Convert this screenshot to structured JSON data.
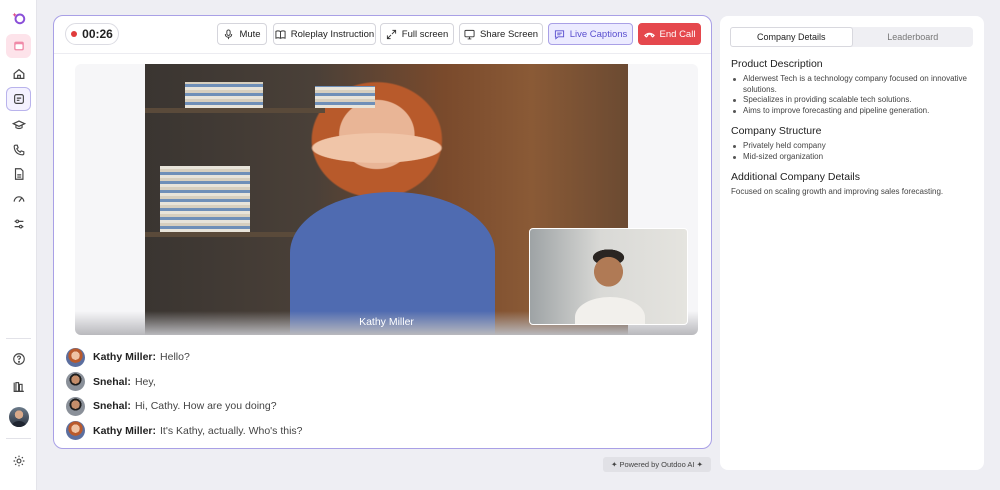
{
  "sidebar": {
    "items": [
      {
        "name": "logo-icon"
      },
      {
        "name": "calendar-app-icon"
      },
      {
        "name": "home-icon"
      },
      {
        "name": "roleplay-icon"
      },
      {
        "name": "learning-icon"
      },
      {
        "name": "calls-icon"
      },
      {
        "name": "documents-icon"
      },
      {
        "name": "analytics-icon"
      },
      {
        "name": "settings-sliders-icon"
      }
    ],
    "bottom": [
      {
        "name": "help-icon"
      },
      {
        "name": "library-icon"
      },
      {
        "name": "user-avatar"
      },
      {
        "name": "gear-icon"
      }
    ]
  },
  "call": {
    "timer": "00:26",
    "toolbar": {
      "mute": "Mute",
      "roleplay_instruction": "Roleplay Instruction",
      "full_screen": "Full screen",
      "share_screen": "Share Screen",
      "live_captions": "Live Captions",
      "end_call": "End Call"
    },
    "main_participant": "Kathy Miller",
    "transcript": [
      {
        "speaker": "Kathy Miller:",
        "text": "Hello?",
        "avatar": "kathy"
      },
      {
        "speaker": "Snehal:",
        "text": "Hey,",
        "avatar": "snehal"
      },
      {
        "speaker": "Snehal:",
        "text": "Hi, Cathy. How are you doing?",
        "avatar": "snehal"
      },
      {
        "speaker": "Kathy Miller:",
        "text": "It's Kathy, actually. Who's this?",
        "avatar": "kathy"
      }
    ],
    "powered_by": "✦ Powered by Outdoo AI ✦"
  },
  "panel": {
    "tabs": [
      "Company Details",
      "Leaderboard"
    ],
    "active_tab": "Company Details",
    "sections": {
      "product_title": "Product Description",
      "product_items": [
        "Alderwest Tech is a technology company focused on innovative solutions.",
        "Specializes in providing scalable tech solutions.",
        "Aims to improve forecasting and pipeline generation."
      ],
      "structure_title": "Company Structure",
      "structure_items": [
        "Privately held company",
        "Mid-sized organization"
      ],
      "additional_title": "Additional Company Details",
      "additional_text": "Focused on scaling growth and improving sales forecasting."
    }
  },
  "colors": {
    "accent": "#7b6fdc",
    "end_call": "#e5484d",
    "live_captions_bg": "#ecebff"
  }
}
